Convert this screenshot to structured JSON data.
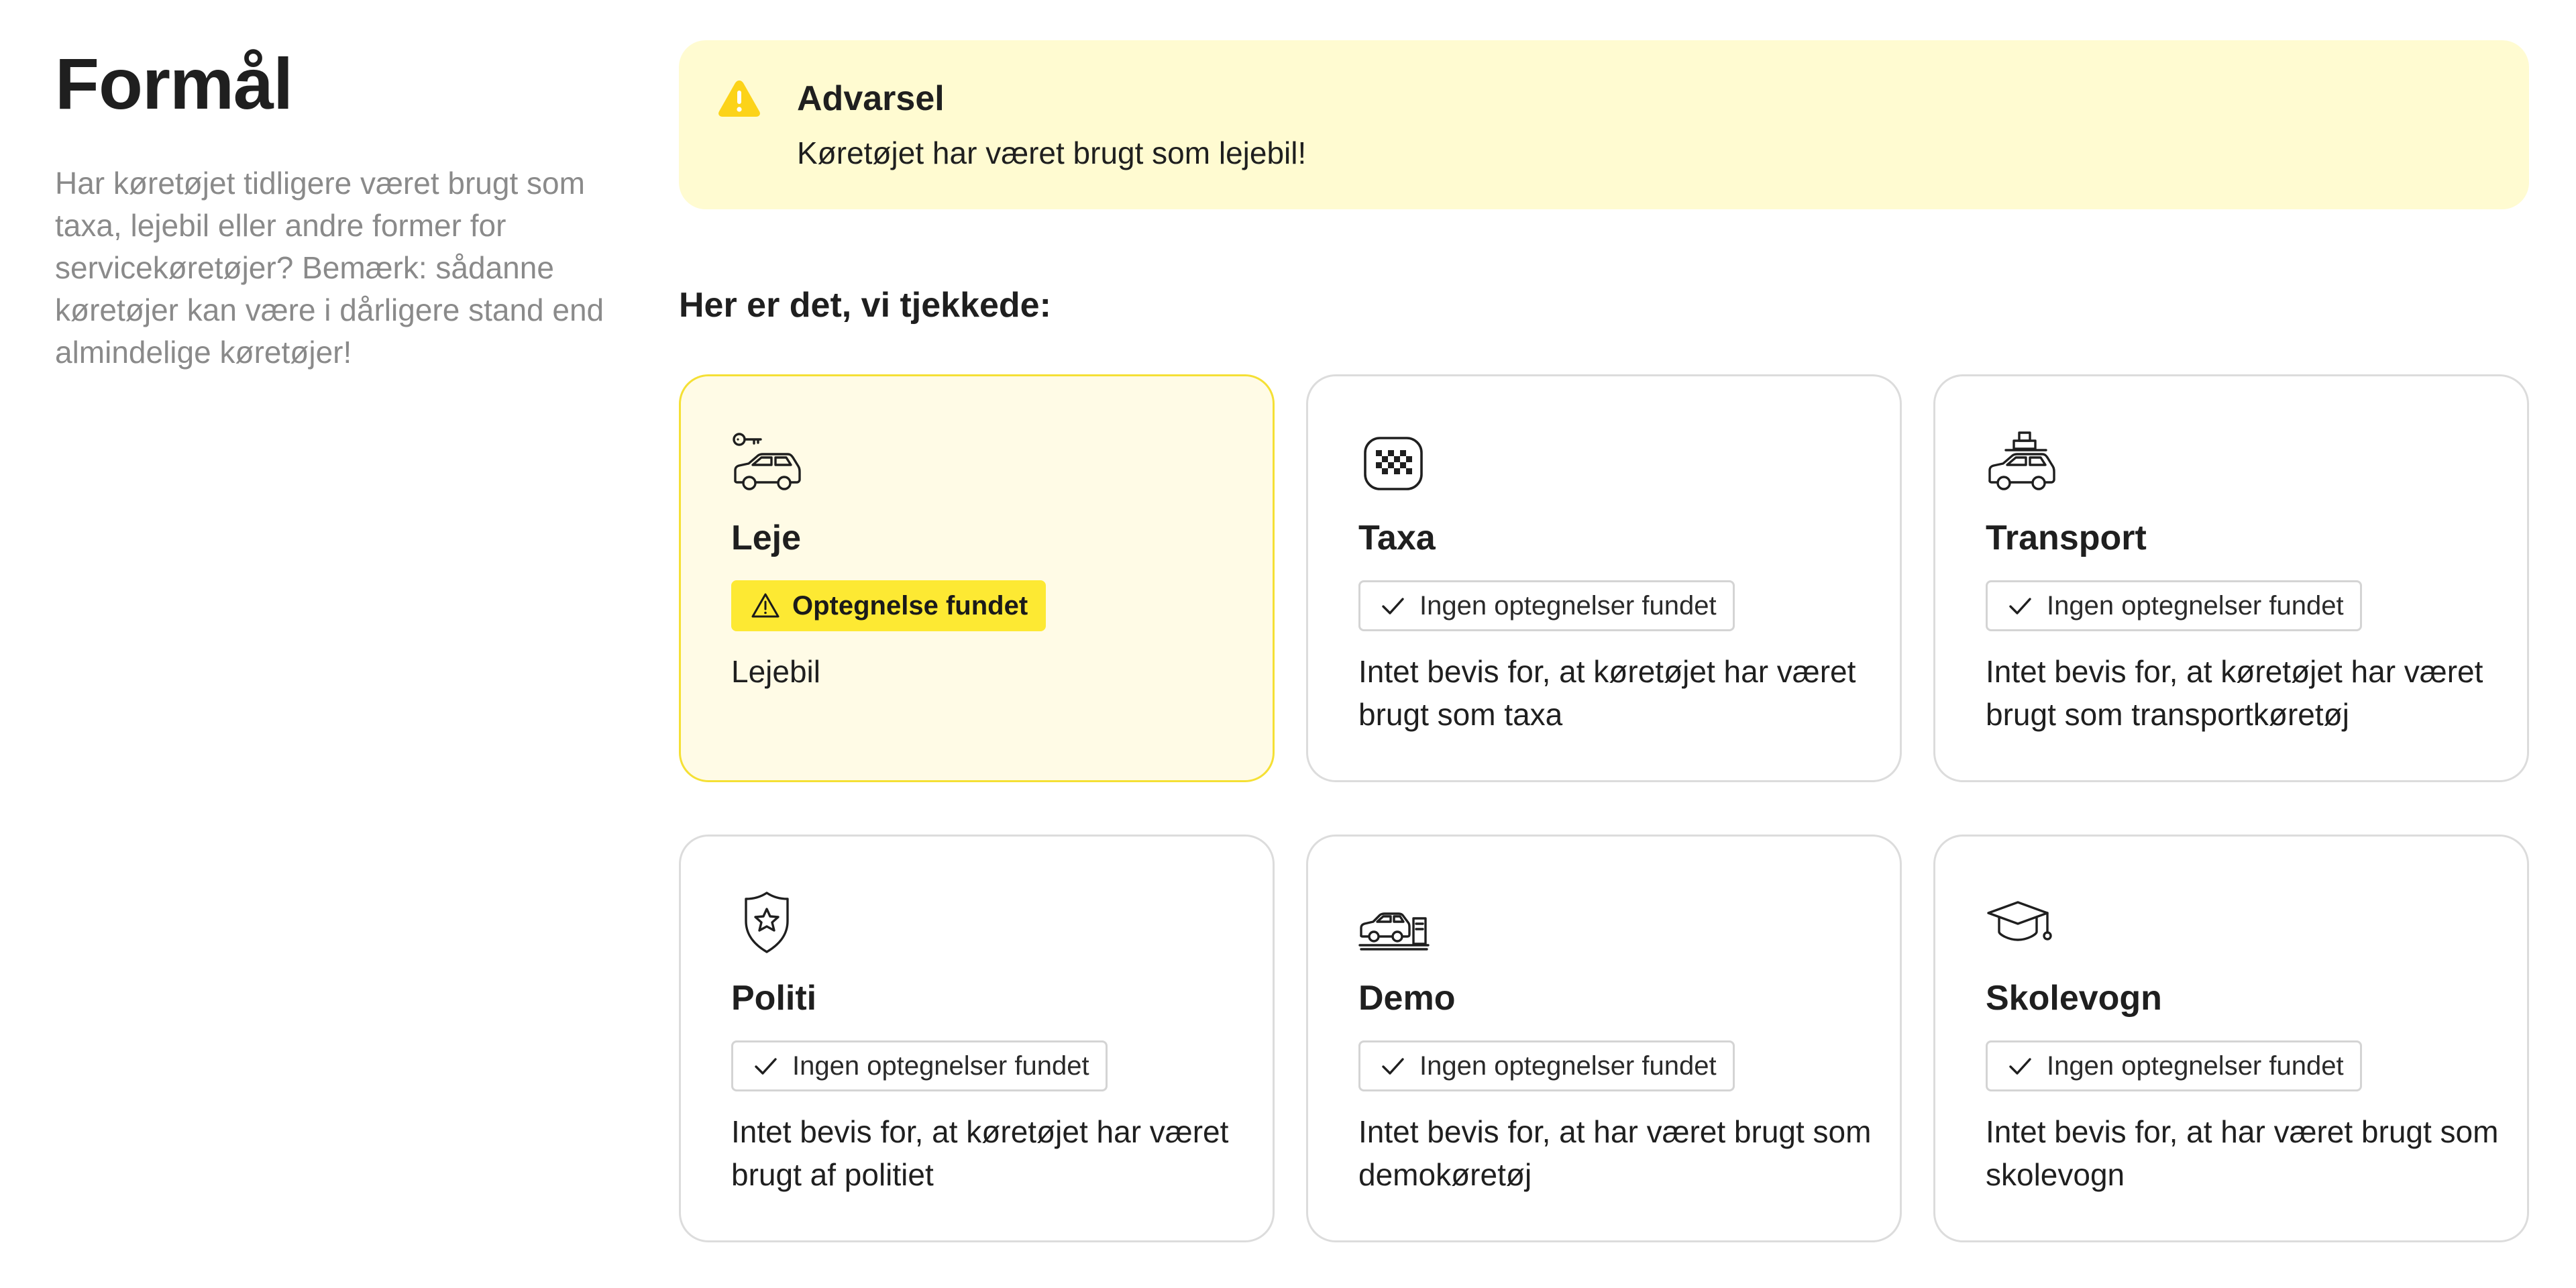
{
  "page": {
    "title": "Formål",
    "description": "Har køretøjet tidligere været brugt som taxa, lejebil eller andre former for servicekøretøjer? Bemærk: sådanne køretøjer kan være i dårligere stand end almindelige køretøjer!"
  },
  "alert": {
    "icon": "warning-triangle-icon",
    "title": "Advarsel",
    "text": "Køretøjet har været brugt som lejebil!",
    "background": "#fffbd1",
    "icon_color": "#fcd319"
  },
  "section": {
    "title": "Her er det, vi tjekkede:"
  },
  "cards": [
    {
      "icon": "rental-car-key-icon",
      "title": "Leje",
      "status": "found",
      "badge": "Optegnelse fundet",
      "badge_icon": "warning-icon",
      "description": "Lejebil"
    },
    {
      "icon": "taxa-sign-icon",
      "title": "Taxa",
      "status": "clear",
      "badge": "Ingen optegnelser fundet",
      "badge_icon": "check-icon",
      "description": "Intet bevis for, at køretøjet har været brugt som taxa"
    },
    {
      "icon": "transport-car-luggage-icon",
      "title": "Transport",
      "status": "clear",
      "badge": "Ingen optegnelser fundet",
      "badge_icon": "check-icon",
      "description": "Intet bevis for, at køretøjet har været brugt som transportkøretøj"
    },
    {
      "icon": "police-shield-star-icon",
      "title": "Politi",
      "status": "clear",
      "badge": "Ingen optegnelser fundet",
      "badge_icon": "check-icon",
      "description": "Intet bevis for, at køretøjet har været brugt af politiet"
    },
    {
      "icon": "demo-car-showroom-icon",
      "title": "Demo",
      "status": "clear",
      "badge": "Ingen optegnelser fundet",
      "badge_icon": "check-icon",
      "description": "Intet bevis for, at har været brugt som demokøretøj"
    },
    {
      "icon": "graduation-cap-icon",
      "title": "Skolevogn",
      "status": "clear",
      "badge": "Ingen optegnelser fundet",
      "badge_icon": "check-icon",
      "description": "Intet bevis for, at har været brugt som skolevogn"
    }
  ],
  "colors": {
    "warning_badge": "#fde933",
    "warning_card_bg": "#fffbe6",
    "warning_card_border": "#f5e035",
    "card_border": "#dcdcdc",
    "muted_text": "#8a8a8a"
  }
}
